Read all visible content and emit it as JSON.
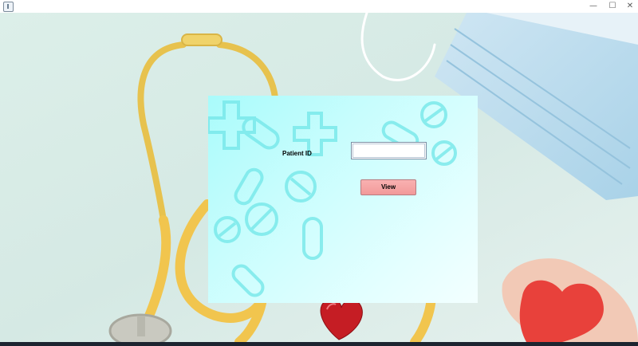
{
  "window": {
    "minimize_glyph": "—",
    "maximize_glyph": "☐",
    "close_glyph": "✕"
  },
  "form": {
    "patient_id_label": "Patient ID",
    "patient_id_value": "",
    "view_button": "View"
  },
  "colors": {
    "panel_accent": "#a9fbfb",
    "button_fill": "#f29999",
    "background": "#d9ece6"
  },
  "icons": [
    "app-icon",
    "stethoscope-image",
    "face-mask-image",
    "heart-image",
    "hand-heart-image",
    "pill-icon",
    "medical-cross-icon"
  ]
}
